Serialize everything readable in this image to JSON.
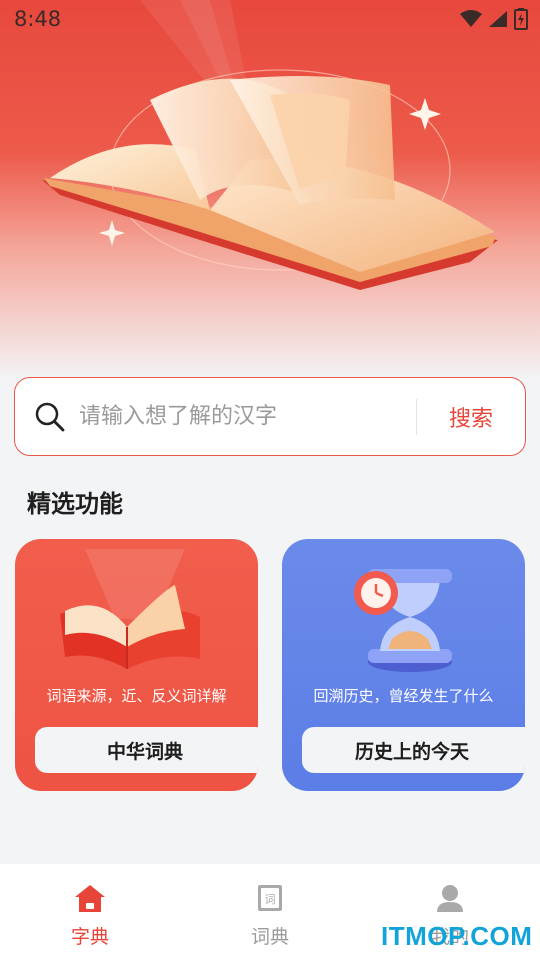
{
  "status_bar": {
    "time": "8:48",
    "icons": [
      "wifi-icon",
      "cellular-signal-icon",
      "battery-charging-icon"
    ]
  },
  "hero": {
    "image": "open-book-illustration",
    "background_color": "#e8483d"
  },
  "search": {
    "placeholder": "请输入想了解的汉字",
    "value": "",
    "button_label": "搜索",
    "accent_color": "#e6453a"
  },
  "section": {
    "title": "精选功能"
  },
  "cards": [
    {
      "description": "词语来源，近、反义词详解",
      "label": "中华词典",
      "icon": "red-book-icon",
      "color": "#ef5745"
    },
    {
      "description": "回溯历史，曾经发生了什么",
      "label": "历史上的今天",
      "icon": "hourglass-clock-icon",
      "color": "#5e7fe7"
    }
  ],
  "bottom_nav": {
    "items": [
      {
        "label": "字典",
        "icon": "home-icon",
        "active": true
      },
      {
        "label": "词典",
        "icon": "dictionary-book-icon",
        "active": false
      },
      {
        "label": "我的",
        "icon": "user-icon",
        "active": false
      }
    ],
    "active_color": "#e8453a",
    "inactive_color": "#9c9c9c"
  },
  "watermark": {
    "text": "ITMOP.COM"
  }
}
